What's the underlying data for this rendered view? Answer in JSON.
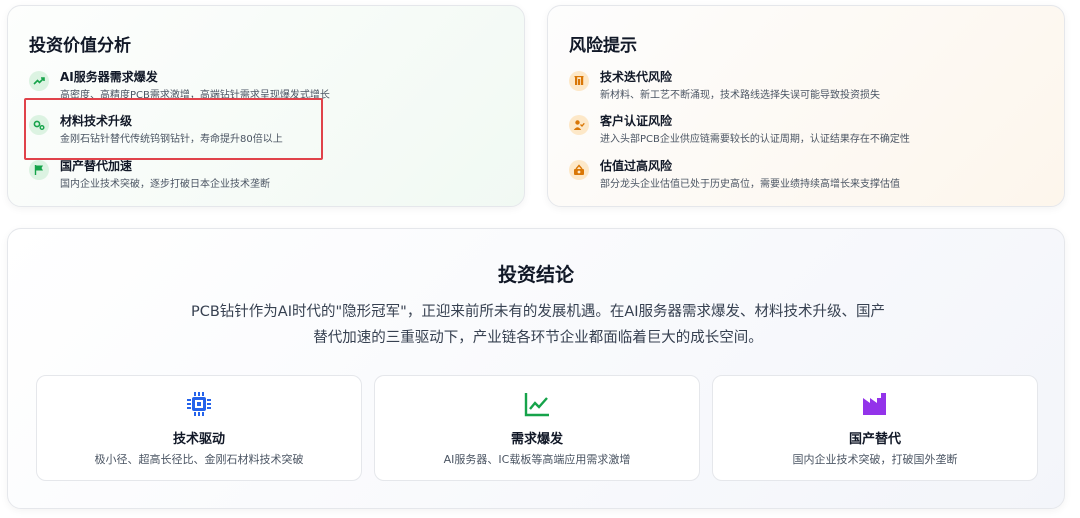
{
  "value_analysis": {
    "title": "投资价值分析",
    "items": [
      {
        "title": "AI服务器需求爆发",
        "desc": "高密度、高精度PCB需求激增，高端钻针需求呈现爆发式增长",
        "icon": "trending-up-icon"
      },
      {
        "title": "材料技术升级",
        "desc": "金刚石钻针替代传统钨钢钻针，寿命提升80倍以上",
        "icon": "gears-icon"
      },
      {
        "title": "国产替代加速",
        "desc": "国内企业技术突破，逐步打破日本企业技术垄断",
        "icon": "flag-icon"
      }
    ]
  },
  "risk": {
    "title": "风险提示",
    "items": [
      {
        "title": "技术迭代风险",
        "desc": "新材料、新工艺不断涌现，技术路线选择失误可能导致投资损失",
        "icon": "flask-icon"
      },
      {
        "title": "客户认证风险",
        "desc": "进入头部PCB企业供应链需要较长的认证周期，认证结果存在不确定性",
        "icon": "user-check-icon"
      },
      {
        "title": "估值过高风险",
        "desc": "部分龙头企业估值已处于历史高位，需要业绩持续高增长来支撑估值",
        "icon": "coins-icon"
      }
    ]
  },
  "conclusion": {
    "title": "投资结论",
    "text": "PCB钻针作为AI时代的\"隐形冠军\"，正迎来前所未有的发展机遇。在AI服务器需求爆发、材料技术升级、国产替代加速的三重驱动下，产业链各环节企业都面临着巨大的成长空间。",
    "features": [
      {
        "title": "技术驱动",
        "desc": "极小径、超高长径比、金刚石材料技术突破",
        "icon": "chip-icon"
      },
      {
        "title": "需求爆发",
        "desc": "AI服务器、IC载板等高端应用需求激增",
        "icon": "chart-line-icon"
      },
      {
        "title": "国产替代",
        "desc": "国内企业技术突破，打破国外垄断",
        "icon": "factory-icon"
      }
    ]
  },
  "colors": {
    "green_icon": "#16a34a",
    "orange_icon": "#d97706",
    "chip_blue": "#2563eb",
    "chart_green": "#16a34a",
    "factory_purple": "#9333ea",
    "highlight_red": "#e0424a"
  }
}
